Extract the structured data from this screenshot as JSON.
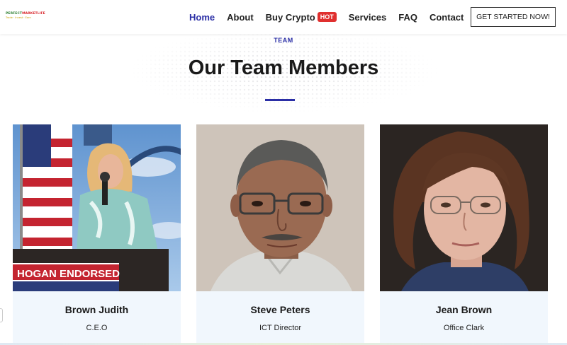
{
  "logo": {
    "brand_part1": "PERFECT",
    "brand_part2": "MARKETLIFE",
    "tagline": "Trade · Invest · Earn"
  },
  "nav": {
    "items": [
      {
        "label": "Home",
        "active": true
      },
      {
        "label": "About"
      },
      {
        "label": "Buy Crypto",
        "badge": "HOT"
      },
      {
        "label": "Services"
      },
      {
        "label": "FAQ"
      },
      {
        "label": "Contact"
      }
    ],
    "cta_label": "GET STARTED NOW!"
  },
  "section": {
    "eyebrow": "TEAM",
    "title": "Our Team Members"
  },
  "team": [
    {
      "name": "Brown Judith",
      "role": "C.E.O",
      "photo_caption": "HOGAN ENDORSED"
    },
    {
      "name": "Steve Peters",
      "role": "ICT Director"
    },
    {
      "name": "Jean Brown",
      "role": "Office Clark"
    }
  ],
  "colors": {
    "accent": "#2b2fa6",
    "hot_badge": "#e0302f",
    "card_bg": "#f1f7fd"
  }
}
